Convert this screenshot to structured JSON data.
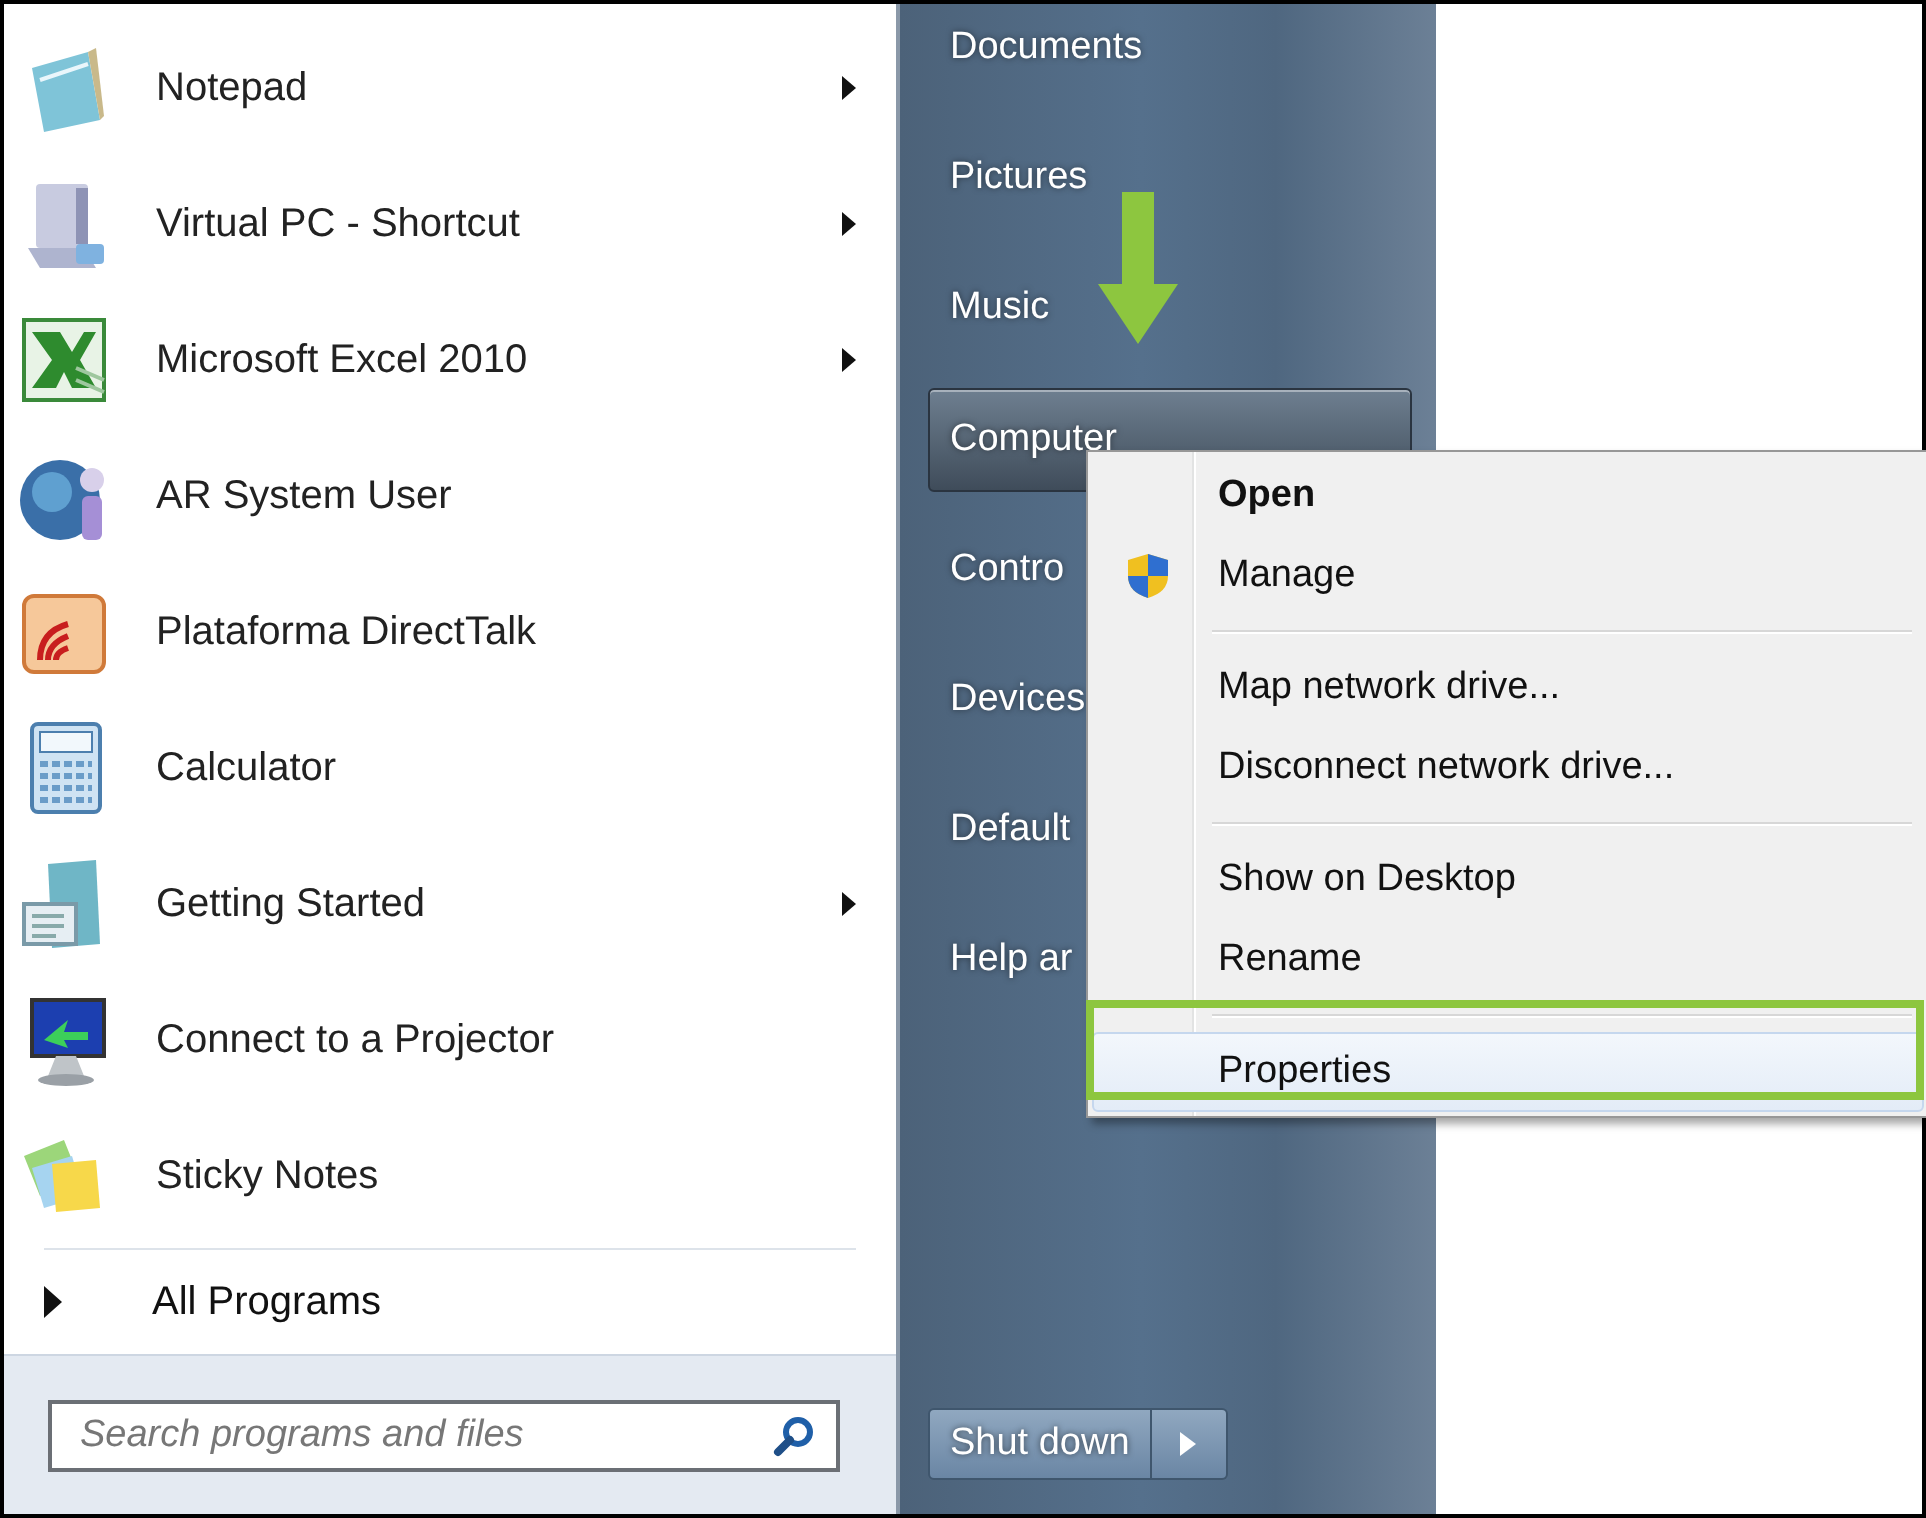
{
  "start_menu": {
    "programs": [
      {
        "label": "Notepad",
        "submenu": true
      },
      {
        "label": "Virtual PC - Shortcut",
        "submenu": true
      },
      {
        "label": "Microsoft Excel 2010",
        "submenu": true
      },
      {
        "label": "AR System User",
        "submenu": false
      },
      {
        "label": "Plataforma DirectTalk",
        "submenu": false
      },
      {
        "label": "Calculator",
        "submenu": false
      },
      {
        "label": "Getting Started",
        "submenu": true
      },
      {
        "label": "Connect to a Projector",
        "submenu": false
      },
      {
        "label": "Sticky Notes",
        "submenu": false
      }
    ],
    "all_programs": {
      "label": "All Programs"
    },
    "search": {
      "placeholder": "Search programs and files"
    },
    "places": [
      {
        "label": "Documents",
        "selected": false
      },
      {
        "label": "Pictures",
        "selected": false
      },
      {
        "label": "Music",
        "selected": false
      },
      {
        "label": "Computer",
        "selected": true
      },
      {
        "label": "Contro",
        "selected": false
      },
      {
        "label": "Devices",
        "selected": false
      },
      {
        "label": "Default",
        "selected": false
      },
      {
        "label": "Help ar",
        "selected": false
      }
    ],
    "shut_down": {
      "label": "Shut down"
    }
  },
  "context_menu": {
    "items": [
      {
        "kind": "item",
        "label": "Open",
        "default": true,
        "shield": false,
        "selected": false
      },
      {
        "kind": "item",
        "label": "Manage",
        "default": false,
        "shield": true,
        "selected": false
      },
      {
        "kind": "separator"
      },
      {
        "kind": "item",
        "label": "Map network drive...",
        "default": false,
        "shield": false,
        "selected": false
      },
      {
        "kind": "item",
        "label": "Disconnect network drive...",
        "default": false,
        "shield": false,
        "selected": false
      },
      {
        "kind": "separator"
      },
      {
        "kind": "item",
        "label": "Show on Desktop",
        "default": false,
        "shield": false,
        "selected": false
      },
      {
        "kind": "item",
        "label": "Rename",
        "default": false,
        "shield": false,
        "selected": false
      },
      {
        "kind": "separator"
      },
      {
        "kind": "item",
        "label": "Properties",
        "default": false,
        "shield": false,
        "selected": true
      }
    ]
  },
  "annotations": {
    "arrow": {
      "color": "#8dc63f"
    },
    "frame": {
      "color": "#8dc63f"
    }
  }
}
